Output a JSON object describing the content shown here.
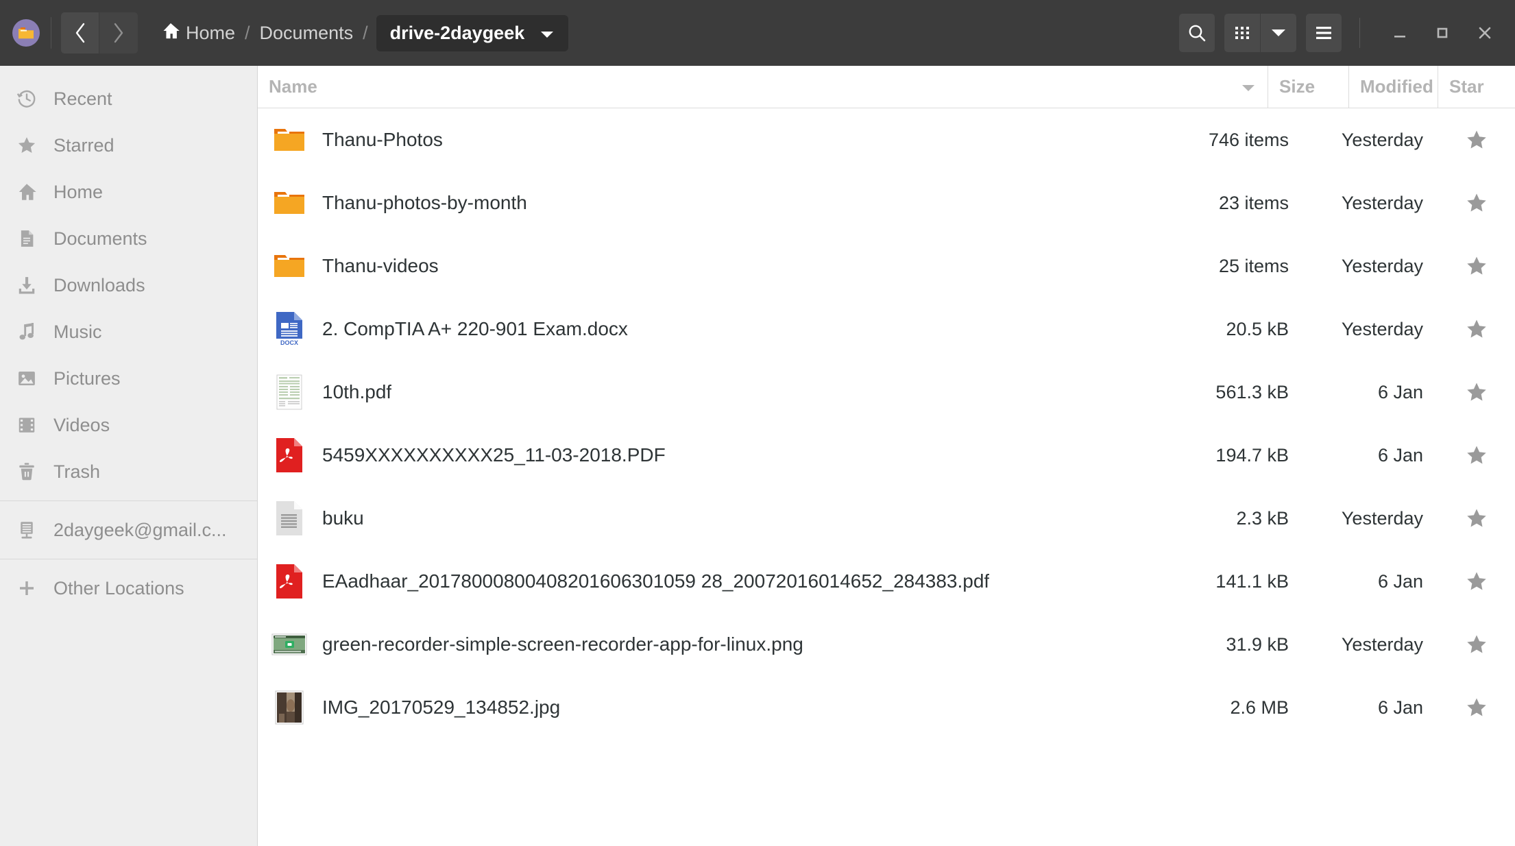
{
  "window": {
    "app_icon": "folder-app-icon",
    "minimize_label": "minimize",
    "maximize_label": "maximize",
    "close_label": "close"
  },
  "header": {
    "back_label": "back",
    "forward_label": "forward",
    "breadcrumb": [
      {
        "label": "Home",
        "icon": "home-icon",
        "current": false
      },
      {
        "label": "Documents",
        "icon": "",
        "current": false
      },
      {
        "label": "drive-2daygeek",
        "icon": "",
        "current": true
      }
    ],
    "separator": "/",
    "search_label": "search",
    "view_grid_label": "view-options",
    "view_dropdown_label": "view-dropdown",
    "menu_label": "main-menu"
  },
  "sidebar": {
    "items": [
      {
        "label": "Recent",
        "icon": "clock-icon"
      },
      {
        "label": "Starred",
        "icon": "star-icon"
      },
      {
        "label": "Home",
        "icon": "home-icon"
      },
      {
        "label": "Documents",
        "icon": "document-icon"
      },
      {
        "label": "Downloads",
        "icon": "download-icon"
      },
      {
        "label": "Music",
        "icon": "music-icon"
      },
      {
        "label": "Pictures",
        "icon": "picture-icon"
      },
      {
        "label": "Videos",
        "icon": "video-icon"
      },
      {
        "label": "Trash",
        "icon": "trash-icon"
      }
    ],
    "mounts": [
      {
        "label": "2daygeek@gmail.c...",
        "icon": "server-icon"
      }
    ],
    "other": {
      "label": "Other Locations",
      "icon": "plus-icon"
    }
  },
  "columns": {
    "name": "Name",
    "size": "Size",
    "modified": "Modified",
    "star": "Star",
    "sort_indicator": "chevron-down-icon"
  },
  "files": [
    {
      "name": "Thanu-Photos",
      "size": "746 items",
      "modified": "Yesterday",
      "icon": "folder-icon",
      "starred": false
    },
    {
      "name": "Thanu-photos-by-month",
      "size": "23 items",
      "modified": "Yesterday",
      "icon": "folder-icon",
      "starred": false
    },
    {
      "name": "Thanu-videos",
      "size": "25 items",
      "modified": "Yesterday",
      "icon": "folder-icon",
      "starred": false
    },
    {
      "name": "2. CompTIA A+ 220-901 Exam.docx",
      "size": "20.5 kB",
      "modified": "Yesterday",
      "icon": "docx-icon",
      "starred": false
    },
    {
      "name": "10th.pdf",
      "size": "561.3 kB",
      "modified": "6 Jan",
      "icon": "pdf-thumbnail-icon",
      "starred": false
    },
    {
      "name": "5459XXXXXXXXXX25_11-03-2018.PDF",
      "size": "194.7 kB",
      "modified": "6 Jan",
      "icon": "pdf-icon",
      "starred": false
    },
    {
      "name": "buku",
      "size": "2.3 kB",
      "modified": "Yesterday",
      "icon": "text-file-icon",
      "starred": false
    },
    {
      "name": "EAadhaar_20178000800408201606301059 28_20072016014652_284383.pdf",
      "size": "141.1 kB",
      "modified": "6 Jan",
      "icon": "pdf-icon",
      "starred": false
    },
    {
      "name": "green-recorder-simple-screen-recorder-app-for-linux.png",
      "size": "31.9 kB",
      "modified": "Yesterday",
      "icon": "png-thumbnail-icon",
      "starred": false
    },
    {
      "name": "IMG_20170529_134852.jpg",
      "size": "2.6 MB",
      "modified": "6 Jan",
      "icon": "jpg-thumbnail-icon",
      "starred": false
    }
  ],
  "colors": {
    "headerbar": "#3c3c3c",
    "sidebar": "#eeeeee",
    "folder": "#f5a623",
    "folder_tab": "#e8740c",
    "pdf": "#e02020",
    "docx": "#3f68c4",
    "accent_purple": "#8b7fb5",
    "text": "#2e3436",
    "muted": "#8e8e8e"
  }
}
